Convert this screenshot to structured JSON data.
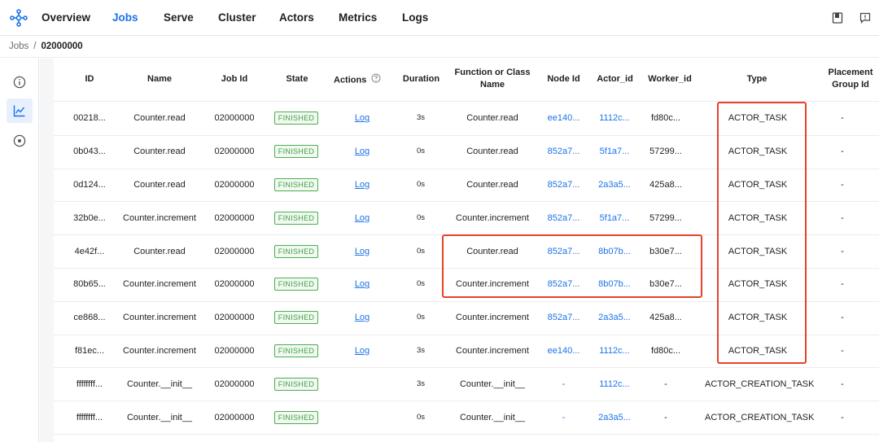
{
  "nav": {
    "items": [
      {
        "label": "Overview",
        "active": false
      },
      {
        "label": "Jobs",
        "active": true
      },
      {
        "label": "Serve",
        "active": false
      },
      {
        "label": "Cluster",
        "active": false
      },
      {
        "label": "Actors",
        "active": false
      },
      {
        "label": "Metrics",
        "active": false
      },
      {
        "label": "Logs",
        "active": false
      }
    ],
    "right_icons": [
      "book-icon",
      "feedback-icon"
    ]
  },
  "breadcrumb": {
    "parent": "Jobs",
    "separator": "/",
    "current": "02000000"
  },
  "rail": {
    "items": [
      "info-icon",
      "chart-line-icon",
      "target-icon"
    ],
    "active": "chart-line-icon"
  },
  "table": {
    "headers": {
      "id": "ID",
      "name": "Name",
      "job_id": "Job Id",
      "state": "State",
      "actions": "Actions",
      "duration": "Duration",
      "function_line1": "Function or Class",
      "function_line2": "Name",
      "node_id": "Node Id",
      "actor_id": "Actor_id",
      "worker_id": "Worker_id",
      "type": "Type",
      "placement_line1": "Placement",
      "placement_line2": "Group Id"
    },
    "rows": [
      {
        "id": "00218...",
        "name": "Counter.read",
        "job_id": "02000000",
        "state": "FINISHED",
        "action": "Log",
        "duration": "3s",
        "function": "Counter.read",
        "node_id": "ee140...",
        "actor_id": "1112c...",
        "worker_id": "fd80c...",
        "type": "ACTOR_TASK",
        "placement": "-"
      },
      {
        "id": "0b043...",
        "name": "Counter.read",
        "job_id": "02000000",
        "state": "FINISHED",
        "action": "Log",
        "duration": "0s",
        "function": "Counter.read",
        "node_id": "852a7...",
        "actor_id": "5f1a7...",
        "worker_id": "57299...",
        "type": "ACTOR_TASK",
        "placement": "-"
      },
      {
        "id": "0d124...",
        "name": "Counter.read",
        "job_id": "02000000",
        "state": "FINISHED",
        "action": "Log",
        "duration": "0s",
        "function": "Counter.read",
        "node_id": "852a7...",
        "actor_id": "2a3a5...",
        "worker_id": "425a8...",
        "type": "ACTOR_TASK",
        "placement": "-"
      },
      {
        "id": "32b0e...",
        "name": "Counter.increment",
        "job_id": "02000000",
        "state": "FINISHED",
        "action": "Log",
        "duration": "0s",
        "function": "Counter.increment",
        "node_id": "852a7...",
        "actor_id": "5f1a7...",
        "worker_id": "57299...",
        "type": "ACTOR_TASK",
        "placement": "-"
      },
      {
        "id": "4e42f...",
        "name": "Counter.read",
        "job_id": "02000000",
        "state": "FINISHED",
        "action": "Log",
        "duration": "0s",
        "function": "Counter.read",
        "node_id": "852a7...",
        "actor_id": "8b07b...",
        "worker_id": "b30e7...",
        "type": "ACTOR_TASK",
        "placement": "-"
      },
      {
        "id": "80b65...",
        "name": "Counter.increment",
        "job_id": "02000000",
        "state": "FINISHED",
        "action": "Log",
        "duration": "0s",
        "function": "Counter.increment",
        "node_id": "852a7...",
        "actor_id": "8b07b...",
        "worker_id": "b30e7...",
        "type": "ACTOR_TASK",
        "placement": "-"
      },
      {
        "id": "ce868...",
        "name": "Counter.increment",
        "job_id": "02000000",
        "state": "FINISHED",
        "action": "Log",
        "duration": "0s",
        "function": "Counter.increment",
        "node_id": "852a7...",
        "actor_id": "2a3a5...",
        "worker_id": "425a8...",
        "type": "ACTOR_TASK",
        "placement": "-"
      },
      {
        "id": "f81ec...",
        "name": "Counter.increment",
        "job_id": "02000000",
        "state": "FINISHED",
        "action": "Log",
        "duration": "3s",
        "function": "Counter.increment",
        "node_id": "ee140...",
        "actor_id": "1112c...",
        "worker_id": "fd80c...",
        "type": "ACTOR_TASK",
        "placement": "-"
      },
      {
        "id": "ffffffff...",
        "name": "Counter.__init__",
        "job_id": "02000000",
        "state": "FINISHED",
        "action": "",
        "duration": "3s",
        "function": "Counter.__init__",
        "node_id": "-",
        "actor_id": "1112c...",
        "worker_id": "-",
        "type": "ACTOR_CREATION_TASK",
        "placement": "-"
      },
      {
        "id": "ffffffff...",
        "name": "Counter.__init__",
        "job_id": "02000000",
        "state": "FINISHED",
        "action": "",
        "duration": "0s",
        "function": "Counter.__init__",
        "node_id": "-",
        "actor_id": "2a3a5...",
        "worker_id": "-",
        "type": "ACTOR_CREATION_TASK",
        "placement": "-"
      }
    ]
  },
  "colors": {
    "accent": "#1a73e8",
    "finished": "#43a047",
    "highlight": "#e8412c"
  }
}
